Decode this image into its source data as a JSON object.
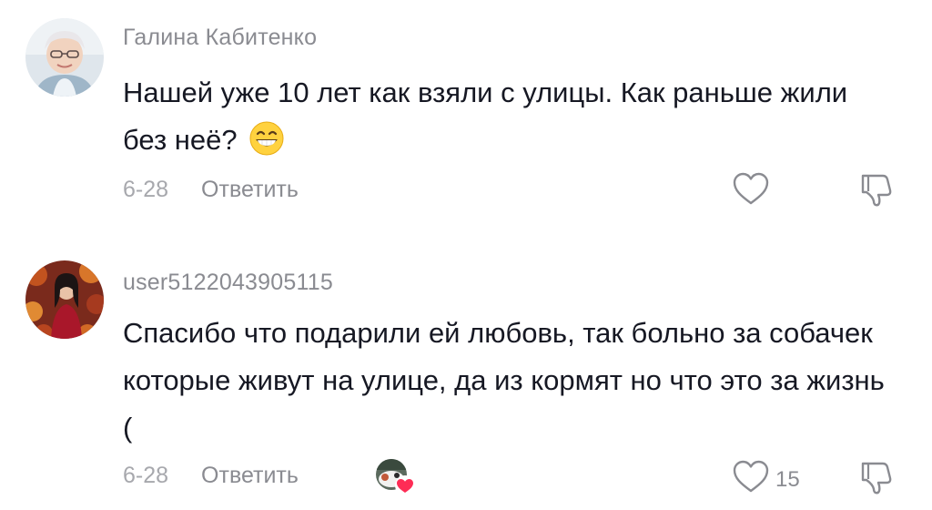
{
  "comments": [
    {
      "username": "Галина Кабитенко",
      "text": "Нашей уже 10 лет как взяли с улицы. Как раньше жили без неё?",
      "emoji": "grinning-face-with-smiling-eyes",
      "date": "6-28",
      "reply_label": "Ответить",
      "likes": ""
    },
    {
      "username": "user5122043905115",
      "text": "Спасибо что подарили ей любовь, так больно за собачек которые живут на улице, да из кормят но что это за жизнь (",
      "date": "6-28",
      "reply_label": "Ответить",
      "likes": "15"
    }
  ],
  "colors": {
    "text": "#161823",
    "secondary": "#8a8b91",
    "muted": "#a7a8ad",
    "heart_badge": "#fe2c55"
  },
  "icons": [
    "heart-outline-icon",
    "dislike-icon",
    "grinning-emoji-icon",
    "creator-liked-heart-icon"
  ]
}
